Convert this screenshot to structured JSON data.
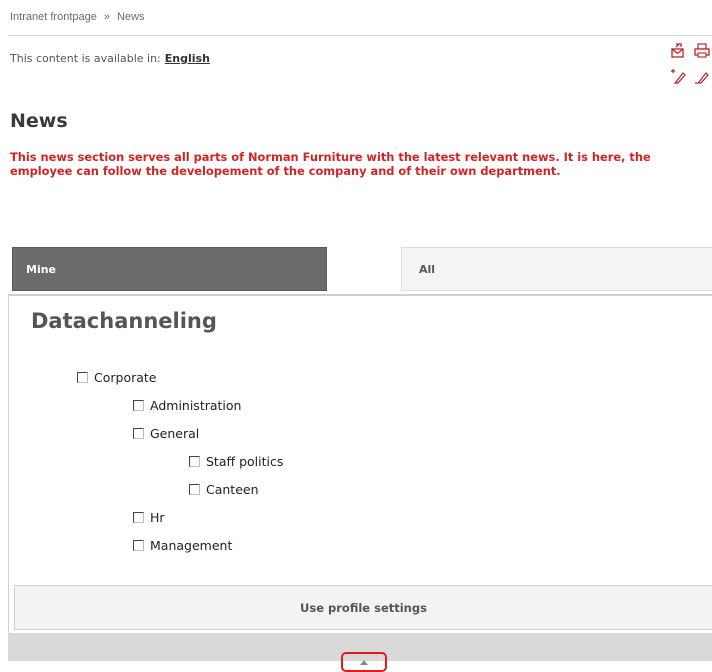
{
  "breadcrumb": {
    "items": [
      "Intranet frontpage",
      "News"
    ],
    "separator": "»"
  },
  "language": {
    "prefix": "This content is available in:",
    "link": "English"
  },
  "toolbar": {
    "icons": [
      "send-icon",
      "print-icon",
      "new-item-icon",
      "edit-icon"
    ]
  },
  "page": {
    "title": "News",
    "intro": "This news section serves all parts of Norman Furniture with the latest relevant news. It is here, the employee can follow the developement of the company and of their own department."
  },
  "tabs": {
    "mine": "Mine",
    "all": "All"
  },
  "panel": {
    "title": "Datachanneling",
    "tree": [
      {
        "label": "Corporate",
        "level": 0,
        "checked": false
      },
      {
        "label": "Administration",
        "level": 1,
        "checked": false
      },
      {
        "label": "General",
        "level": 1,
        "checked": false
      },
      {
        "label": "Staff politics",
        "level": 2,
        "checked": false
      },
      {
        "label": "Canteen",
        "level": 2,
        "checked": false
      },
      {
        "label": "Hr",
        "level": 1,
        "checked": false
      },
      {
        "label": "Management",
        "level": 1,
        "checked": false
      }
    ],
    "profile_button": "Use profile settings"
  },
  "colors": {
    "accent_red": "#d32323",
    "tab_active": "#6b6b6b",
    "highlight": "#e21a1a"
  }
}
